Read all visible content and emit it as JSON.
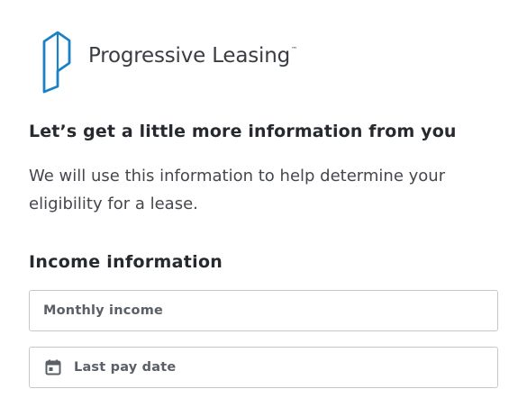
{
  "brand": {
    "name": "Progressive Leasing",
    "trademark": "™",
    "logo_icon": "progressive-p-logo",
    "color": "#1a82c4"
  },
  "page": {
    "heading": "Let’s get a little more information from you",
    "description": "We will use this information to help determine your eligibility for a lease."
  },
  "income_section": {
    "title": "Income information",
    "monthly_income": {
      "placeholder": "Monthly income",
      "value": ""
    },
    "last_pay_date": {
      "placeholder": "Last pay date",
      "value": "",
      "icon": "calendar-icon"
    }
  }
}
